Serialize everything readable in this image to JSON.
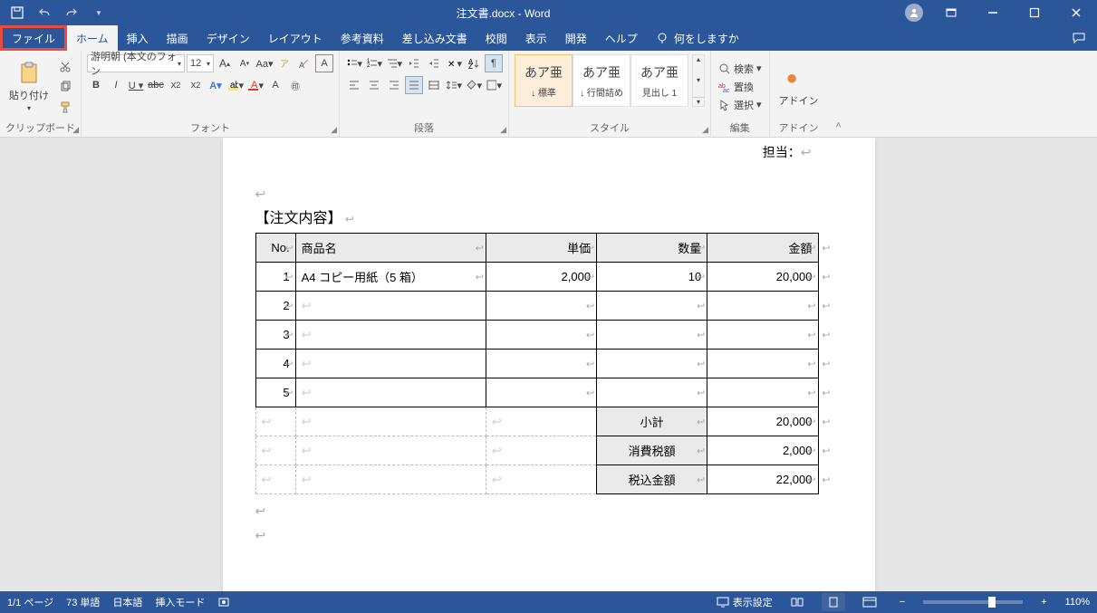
{
  "title": "注文書.docx  -  Word",
  "qa": {
    "save": "保存",
    "undo": "元に戻す",
    "redo": "やり直し"
  },
  "tabs": {
    "file": "ファイル",
    "home": "ホーム",
    "insert": "挿入",
    "draw": "描画",
    "design": "デザイン",
    "layout": "レイアウト",
    "references": "参考資料",
    "mailings": "差し込み文書",
    "review": "校閲",
    "view": "表示",
    "developer": "開発",
    "help": "ヘルプ",
    "tell_me": "何をしますか"
  },
  "ribbon": {
    "clipboard": {
      "label": "クリップボード",
      "paste": "貼り付け"
    },
    "font": {
      "label": "フォント",
      "name": "游明朝 (本文のフォン",
      "size": "12"
    },
    "paragraph": {
      "label": "段落"
    },
    "styles": {
      "label": "スタイル",
      "items": [
        {
          "preview": "あア亜",
          "name": "↓ 標準"
        },
        {
          "preview": "あア亜",
          "name": "↓ 行間詰め"
        },
        {
          "preview": "あア亜",
          "name": "見出し 1"
        }
      ]
    },
    "editing": {
      "label": "編集",
      "find": "検索",
      "replace": "置換",
      "select": "選択"
    },
    "addins": {
      "label": "アドイン",
      "btn": "アドイン"
    }
  },
  "doc": {
    "tantou": "担当：",
    "heading": "【注文内容】",
    "headers": {
      "no": "No.",
      "name": "商品名",
      "price": "単価",
      "qty": "数量",
      "amount": "金額"
    },
    "rows": [
      {
        "no": "1",
        "name": "A4 コピー用紙（5 箱）",
        "price": "2,000",
        "qty": "10",
        "amount": "20,000"
      },
      {
        "no": "2",
        "name": "",
        "price": "",
        "qty": "",
        "amount": ""
      },
      {
        "no": "3",
        "name": "",
        "price": "",
        "qty": "",
        "amount": ""
      },
      {
        "no": "4",
        "name": "",
        "price": "",
        "qty": "",
        "amount": ""
      },
      {
        "no": "5",
        "name": "",
        "price": "",
        "qty": "",
        "amount": ""
      }
    ],
    "footer": {
      "subtotal_label": "小計",
      "subtotal": "20,000",
      "tax_label": "消費税額",
      "tax": "2,000",
      "total_label": "税込金額",
      "total": "22,000"
    }
  },
  "status": {
    "page": "1/1 ページ",
    "words": "73 単語",
    "lang": "日本語",
    "insert_mode": "挿入モード",
    "display": "表示設定",
    "zoom": "110%"
  }
}
